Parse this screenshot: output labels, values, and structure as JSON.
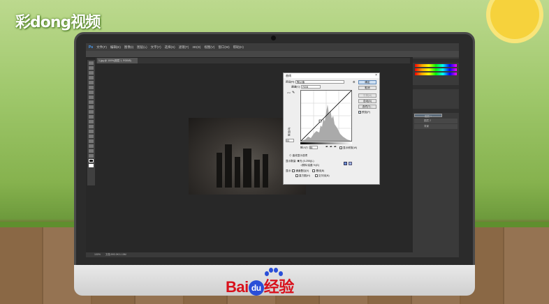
{
  "brand": {
    "logo_text": "彩dong视频",
    "watermark_bai": "Bai",
    "watermark_du": "du",
    "watermark_suffix": "经验"
  },
  "photoshop": {
    "menus": [
      "文件(F)",
      "编辑(E)",
      "图像(I)",
      "图层(L)",
      "文字(Y)",
      "选择(S)",
      "滤镜(T)",
      "3D(D)",
      "视图(V)",
      "窗口(W)",
      "帮助(H)"
    ],
    "doc_tab": "1.jpg @ 100%(图层 1, RGB/8)",
    "status_zoom": "100%",
    "status_doc": "文档:593.0K/1.15M"
  },
  "curves_dialog": {
    "title": "曲线",
    "preset_label": "预设(R):",
    "preset_value": "默认值",
    "channel_label": "通道(C):",
    "channel_value": "RGB",
    "buttons": {
      "ok": "确定",
      "cancel": "取消",
      "smooth": "平滑(M)",
      "auto": "自动(A)",
      "options": "选项(T)..."
    },
    "preview_label": "预览(P)",
    "output_label": "输出(O):",
    "output_value": "93",
    "input_label": "输入(I):",
    "input_value": "85",
    "show_clipping": "显示修剪(W)",
    "display_options": "曲线显示选项",
    "show_amount": "显示数量:",
    "light_option": "光 (0-255)(L)",
    "pigment_option": "颜料/油墨 %(G)",
    "show_label": "显示:",
    "channel_overlays": "通道叠加(V)",
    "baseline": "基线(B)",
    "histogram": "直方图(H)",
    "intersection": "交叉线(N)"
  },
  "layers": [
    "图层 1",
    "图层 2",
    "背景"
  ]
}
